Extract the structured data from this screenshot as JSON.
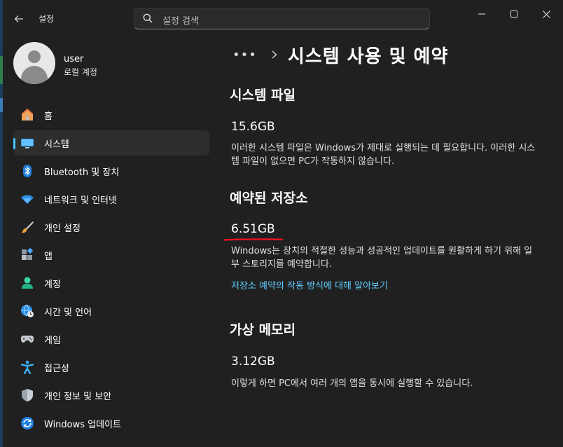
{
  "app": {
    "title": "설정",
    "search_placeholder": "설정 검색"
  },
  "profile": {
    "name": "user",
    "account_type": "로컬 계정"
  },
  "sidebar": {
    "selected_index": 1,
    "items": [
      {
        "label": "홈",
        "icon": "home-icon"
      },
      {
        "label": "시스템",
        "icon": "system-monitor-icon"
      },
      {
        "label": "Bluetooth 및 장치",
        "icon": "bluetooth-icon"
      },
      {
        "label": "네트워크 및 인터넷",
        "icon": "wifi-icon"
      },
      {
        "label": "개인 설정",
        "icon": "brush-icon"
      },
      {
        "label": "앱",
        "icon": "apps-icon"
      },
      {
        "label": "계정",
        "icon": "account-icon"
      },
      {
        "label": "시간 및 언어",
        "icon": "globe-clock-icon"
      },
      {
        "label": "게임",
        "icon": "gamepad-icon"
      },
      {
        "label": "접근성",
        "icon": "accessibility-icon"
      },
      {
        "label": "개인 정보 및 보안",
        "icon": "shield-icon"
      },
      {
        "label": "Windows 업데이트",
        "icon": "update-icon"
      }
    ]
  },
  "breadcrumb": {
    "overflow": "•••",
    "title": "시스템 사용 및 예약"
  },
  "sections": {
    "system_files": {
      "title": "시스템 파일",
      "size": "15.6GB",
      "description": "이러한 시스템 파일은 Windows가 제대로 실행되는 데 필요합니다. 이러한 시스템 파일이 없으면 PC가 작동하지 않습니다."
    },
    "reserved_storage": {
      "title": "예약된 저장소",
      "size": "6.51GB",
      "description": "Windows는 장치의 적절한 성능과 성공적인 업데이트를 원활하게 하기 위해 일부 스토리지를 예약합니다.",
      "link": "저장소 예약의 작동 방식에 대해 알아보기"
    },
    "virtual_memory": {
      "title": "가상 메모리",
      "size": "3.12GB",
      "description": "이렇게 하면 PC에서 여러 개의 앱을 동시에 실행할 수 있습니다."
    }
  },
  "colors": {
    "accent": "#4cc2ff",
    "link": "#60cdff",
    "annotation": "#e81123"
  }
}
